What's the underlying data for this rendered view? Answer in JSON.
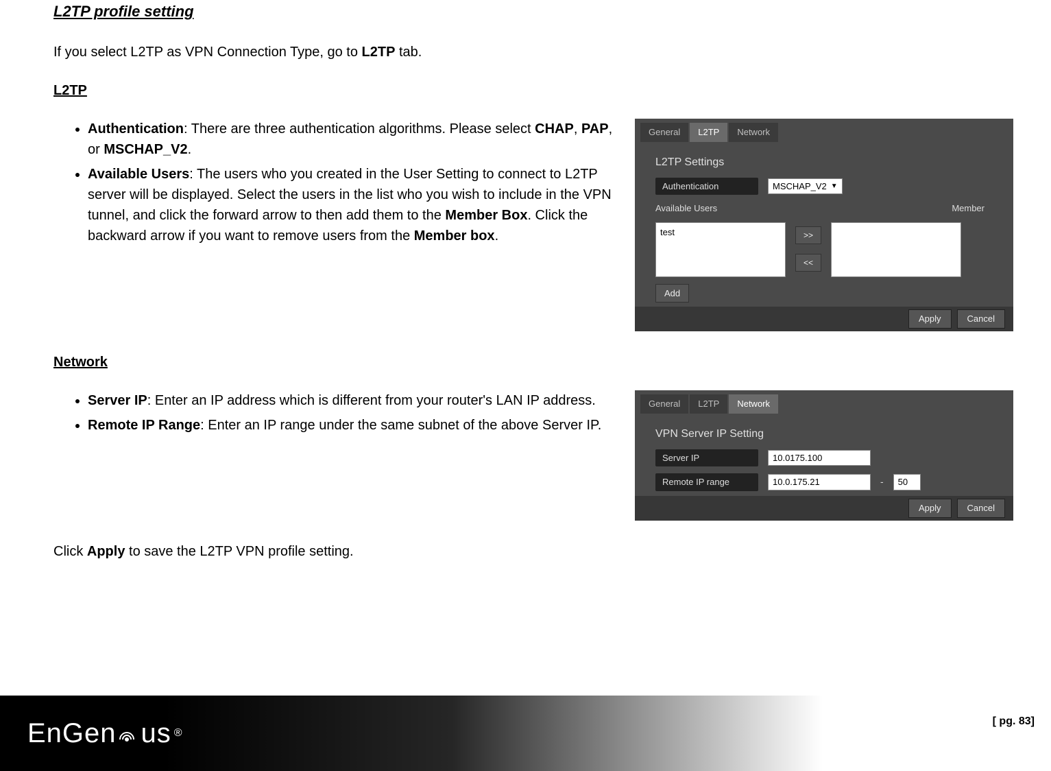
{
  "title": "L2TP profile setting",
  "intro": {
    "pre": "If you select L2TP as VPN Connection Type, go to ",
    "bold": "L2TP",
    "post": " tab."
  },
  "section_l2tp": {
    "heading": "L2TP",
    "bullet1": {
      "lead": "Authentication",
      "text1": ": There are three authentication algorithms. Please select ",
      "opt1": "CHAP",
      "sep1": ", ",
      "opt2": "PAP",
      "sep2": ", or ",
      "opt3": "MSCHAP_V2",
      "end": "."
    },
    "bullet2": {
      "lead": "Available Users",
      "text1": ": The users who you created in the User Setting to connect to L2TP server will be displayed. Select the users in the list who you wish to include in the VPN tunnel, and click the forward arrow to then add them to the ",
      "boldA": "Member Box",
      "text2": ". Click the backward arrow if you want to remove users from the ",
      "boldB": "Member box",
      "end": "."
    }
  },
  "section_network": {
    "heading": "Network",
    "bullet1": {
      "lead": "Server IP",
      "text": ": Enter an IP address which is different from your router's LAN IP address."
    },
    "bullet2": {
      "lead": "Remote IP Range",
      "text": ": Enter an IP range under the same subnet of the above Server IP."
    }
  },
  "apply_note": {
    "pre": "Click ",
    "bold": "Apply",
    "post": " to save the L2TP VPN profile setting."
  },
  "mock1": {
    "tabs": {
      "general": "General",
      "l2tp": "L2TP",
      "network": "Network"
    },
    "panel_title": "L2TP Settings",
    "auth_label": "Authentication",
    "auth_value": "MSCHAP_V2",
    "avail_label": "Available Users",
    "member_label": "Member",
    "list_item": "test",
    "fwd": ">>",
    "back": "<<",
    "add": "Add",
    "apply": "Apply",
    "cancel": "Cancel"
  },
  "mock2": {
    "tabs": {
      "general": "General",
      "l2tp": "L2TP",
      "network": "Network"
    },
    "panel_title": "VPN Server IP Setting",
    "server_ip_label": "Server IP",
    "server_ip_value": "10.0175.100",
    "range_label": "Remote IP range",
    "range_start": "10.0.175.21",
    "range_dash": "-",
    "range_end": "50",
    "apply": "Apply",
    "cancel": "Cancel"
  },
  "footer": {
    "brand_a": "EnGen",
    "brand_b": "us",
    "reg": "®"
  },
  "page_number": "[ pg. 83]"
}
